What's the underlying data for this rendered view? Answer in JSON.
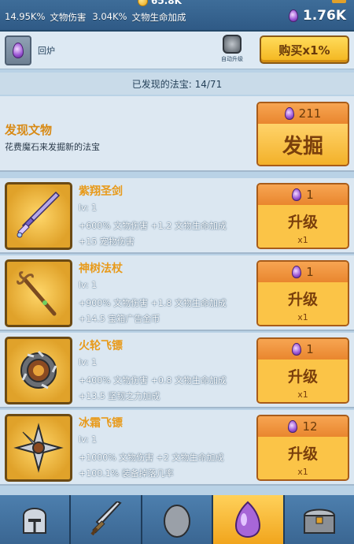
{
  "top": {
    "gold": "65.8K",
    "stat1_value": "14.95K%",
    "stat1_label": "文物伤害",
    "stat2_value": "3.04K%",
    "stat2_label": "文物生命加成",
    "mana": "1.76K"
  },
  "subbar": {
    "slot_label": "回炉",
    "auto_upgrade_label": "自动升级",
    "buy_label": "购买x1%"
  },
  "discovered_text": "已发现的法宝: 14/71",
  "discover": {
    "title": "发现文物",
    "desc": "花费魔石来发掘新的法宝",
    "cost": "211",
    "action": "发掘"
  },
  "relics": [
    {
      "name": "紫翔圣剑",
      "lv": "lv: 1",
      "eff1": "+600% 文物伤害 +1.2 文物生命加成",
      "eff2": "+15 宠物伤害",
      "cost": "1",
      "action": "升级",
      "mult": "x1",
      "icon": "sword-icon"
    },
    {
      "name": "神树法杖",
      "lv": "lv: 1",
      "eff1": "+900% 文物伤害 +1.8 文物生命加成",
      "eff2": "+14.5 宝箱广告金币",
      "cost": "1",
      "action": "升级",
      "mult": "x1",
      "icon": "staff-icon"
    },
    {
      "name": "火轮飞镖",
      "lv": "lv: 1",
      "eff1": "+400% 文物伤害 +0.8 文物生命加成",
      "eff2": "+13.5 坚韧之力加成",
      "cost": "1",
      "action": "升级",
      "mult": "x1",
      "icon": "ring-blade-icon"
    },
    {
      "name": "冰霜飞镖",
      "lv": "lv: 1",
      "eff1": "+1000% 文物伤害 +2 文物生命加成",
      "eff2": "+100.1% 装备掉落几率",
      "cost": "12",
      "action": "升级",
      "mult": "x1",
      "icon": "shuriken-icon"
    }
  ],
  "nav": [
    "helmet-icon",
    "sword-icon",
    "egg-icon",
    "gem-icon",
    "chest-icon"
  ],
  "colors": {
    "accent": "#f3b51e",
    "panel": "#dbe7f1",
    "header": "#2f5a86"
  }
}
